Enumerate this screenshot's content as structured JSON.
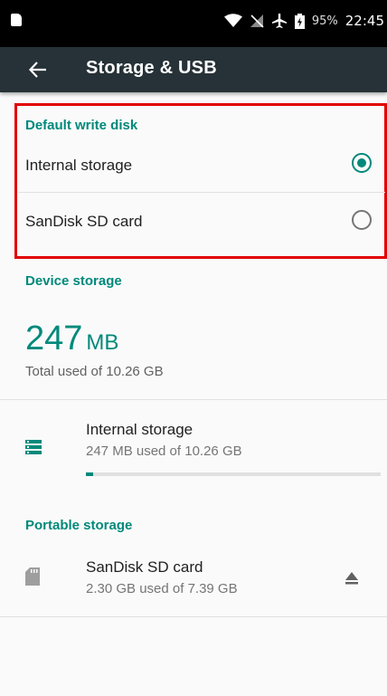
{
  "status_bar": {
    "battery_percent": "95%",
    "time": "22:45",
    "icons": [
      "sim-icon",
      "wifi-icon",
      "no-signal-icon",
      "airplane-icon",
      "battery-icon"
    ]
  },
  "app_bar": {
    "title": "Storage & USB",
    "back_icon": "arrow-back-icon",
    "background": "#263238"
  },
  "default_write_disk": {
    "header": "Default write disk",
    "options": [
      {
        "label": "Internal storage",
        "selected": true
      },
      {
        "label": "SanDisk SD card",
        "selected": false
      }
    ]
  },
  "device_storage": {
    "header": "Device storage",
    "used_value": "247",
    "used_unit": "MB",
    "total_text": "Total used of 10.26 GB",
    "volumes": [
      {
        "title": "Internal storage",
        "summary": "247 MB used of 10.26 GB",
        "icon": "storage-icon",
        "used_fraction": 0.024
      }
    ]
  },
  "portable_storage": {
    "header": "Portable storage",
    "volumes": [
      {
        "title": "SanDisk SD card",
        "summary": "2.30 GB used of 7.39 GB",
        "icon": "sd-card-icon",
        "action_icon": "eject-icon"
      }
    ]
  },
  "colors": {
    "accent": "#00897b",
    "highlight_border": "#e10000"
  }
}
